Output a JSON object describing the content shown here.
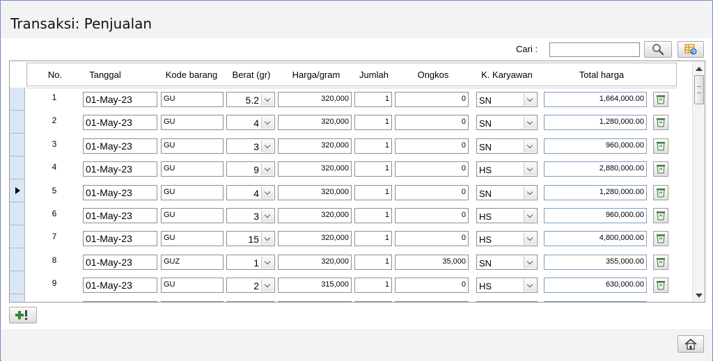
{
  "title": "Transaksi: Penjualan",
  "search": {
    "label": "Cari :",
    "value": ""
  },
  "toolbar": {
    "search_icon": "magnifier-icon",
    "refresh_icon": "table-refresh-icon"
  },
  "columns": [
    "No.",
    "Tanggal",
    "Kode barang",
    "Berat (gr)",
    "Harga/gram",
    "Jumlah",
    "Ongkos",
    "K. Karyawan",
    "Total harga"
  ],
  "rows": [
    {
      "no": "1",
      "tanggal": "01-May-23",
      "kode": "GU",
      "berat": "5.2",
      "harga": "320,000",
      "jumlah": "1",
      "ongkos": "0",
      "karyawan": "SN",
      "total": "1,664,000.00"
    },
    {
      "no": "2",
      "tanggal": "01-May-23",
      "kode": "GU",
      "berat": "4",
      "harga": "320,000",
      "jumlah": "1",
      "ongkos": "0",
      "karyawan": "SN",
      "total": "1,280,000.00"
    },
    {
      "no": "3",
      "tanggal": "01-May-23",
      "kode": "GU",
      "berat": "3",
      "harga": "320,000",
      "jumlah": "1",
      "ongkos": "0",
      "karyawan": "SN",
      "total": "960,000.00"
    },
    {
      "no": "4",
      "tanggal": "01-May-23",
      "kode": "GU",
      "berat": "9",
      "harga": "320,000",
      "jumlah": "1",
      "ongkos": "0",
      "karyawan": "HS",
      "total": "2,880,000.00"
    },
    {
      "no": "5",
      "tanggal": "01-May-23",
      "kode": "GU",
      "berat": "4",
      "harga": "320,000",
      "jumlah": "1",
      "ongkos": "0",
      "karyawan": "SN",
      "total": "1,280,000.00"
    },
    {
      "no": "6",
      "tanggal": "01-May-23",
      "kode": "GU",
      "berat": "3",
      "harga": "320,000",
      "jumlah": "1",
      "ongkos": "0",
      "karyawan": "HS",
      "total": "960,000.00"
    },
    {
      "no": "7",
      "tanggal": "01-May-23",
      "kode": "GU",
      "berat": "15",
      "harga": "320,000",
      "jumlah": "1",
      "ongkos": "0",
      "karyawan": "HS",
      "total": "4,800,000.00"
    },
    {
      "no": "8",
      "tanggal": "01-May-23",
      "kode": "GUZ",
      "berat": "1",
      "harga": "320,000",
      "jumlah": "1",
      "ongkos": "35,000",
      "karyawan": "SN",
      "total": "355,000.00"
    },
    {
      "no": "9",
      "tanggal": "01-May-23",
      "kode": "GU",
      "berat": "2",
      "harga": "315,000",
      "jumlah": "1",
      "ongkos": "0",
      "karyawan": "HS",
      "total": "630,000.00"
    }
  ],
  "current_row": "5",
  "buttons": {
    "add_record_icon": "add-record-icon",
    "home_icon": "home-icon",
    "delete_icon": "trash-icon"
  }
}
